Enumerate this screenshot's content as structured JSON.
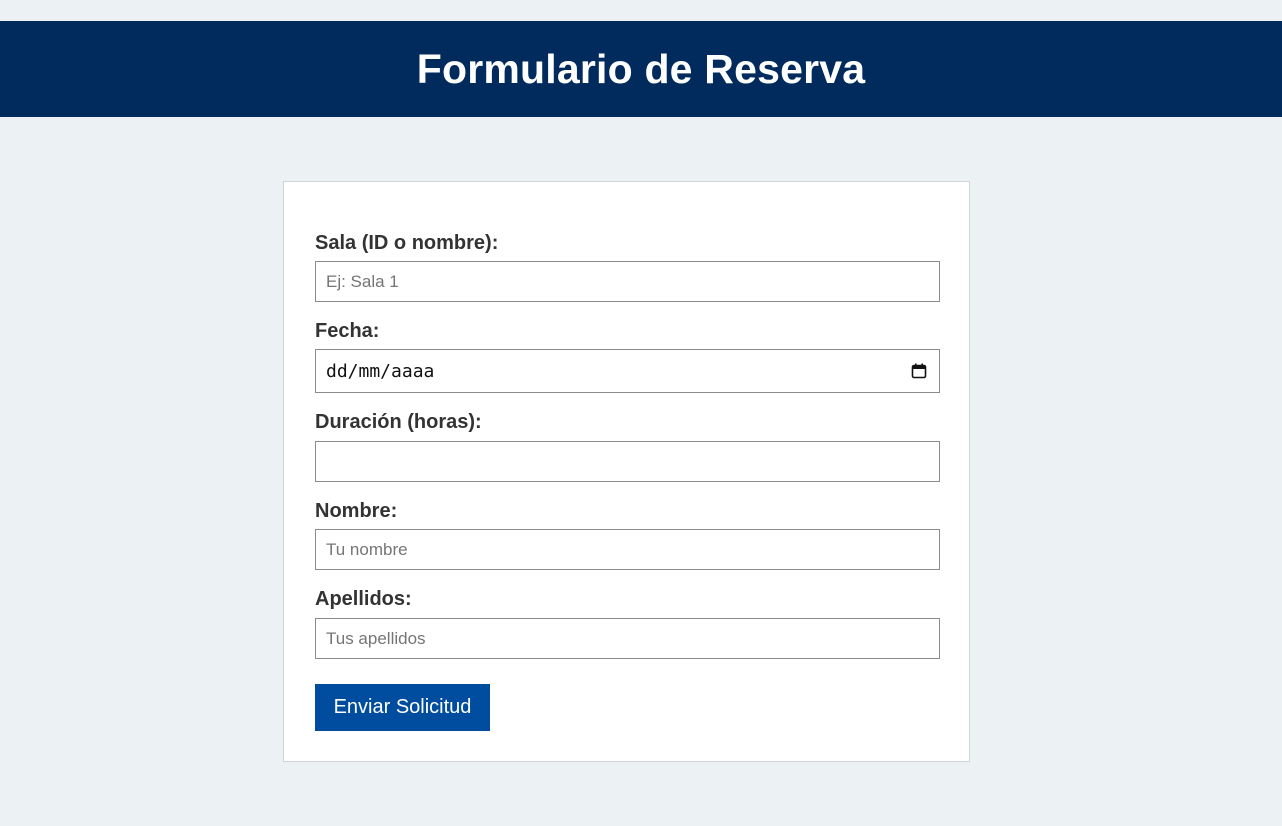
{
  "header": {
    "title": "Formulario de Reserva"
  },
  "form": {
    "sala": {
      "label": "Sala (ID o nombre):",
      "placeholder": "Ej: Sala 1",
      "value": ""
    },
    "fecha": {
      "label": "Fecha:",
      "display": "dd/mm/aaaa",
      "icon": "calendar-icon"
    },
    "duracion": {
      "label": "Duración (horas):",
      "value": ""
    },
    "nombre": {
      "label": "Nombre:",
      "placeholder": "Tu nombre",
      "value": ""
    },
    "apellidos": {
      "label": "Apellidos:",
      "placeholder": "Tus apellidos",
      "value": ""
    },
    "submit_label": "Enviar Solicitud"
  },
  "colors": {
    "header_bg": "#002b5c",
    "page_bg": "#ecf1f4",
    "button_bg": "#004c9e",
    "label_text": "#333333"
  }
}
